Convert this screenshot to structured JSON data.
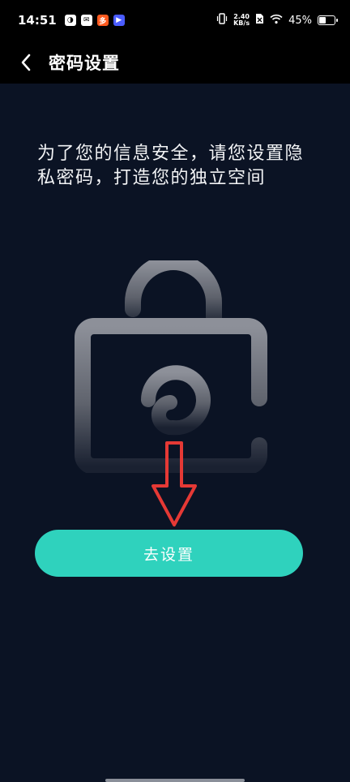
{
  "status_bar": {
    "time": "14:51",
    "net_speed_value": "2.40",
    "net_speed_unit": "KB/s",
    "battery_percent": "45%",
    "battery_level": 0.45
  },
  "nav": {
    "title": "密码设置"
  },
  "main": {
    "message": "为了您的信息安全，请您设置隐私密码，打造您的独立空间",
    "button_label": "去设置"
  },
  "colors": {
    "background": "#0b1324",
    "accent": "#2fd2bd",
    "annotation": "#e53935"
  }
}
